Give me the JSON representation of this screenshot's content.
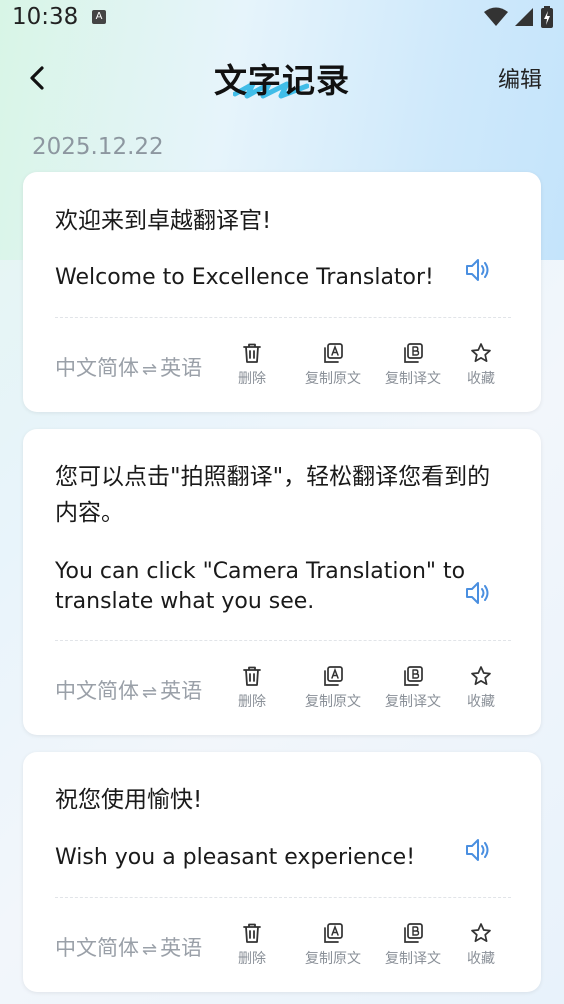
{
  "status": {
    "time": "10:38",
    "notification_badge": "A"
  },
  "header": {
    "title": "文字记录",
    "edit_label": "编辑"
  },
  "date": "2025.12.22",
  "records": [
    {
      "source": "欢迎来到卓越翻译官!",
      "target": "Welcome to Excellence Translator!",
      "lang_from": "中文简体",
      "lang_to": "英语",
      "swap_symbol": "⇌",
      "actions": {
        "delete": "删除",
        "copy_source": "复制原文",
        "copy_target": "复制译文",
        "favorite": "收藏"
      }
    },
    {
      "source": "您可以点击\"拍照翻译\"，轻松翻译您看到的内容。",
      "target": "You can click \"Camera Translation\" to translate what you see.",
      "lang_from": "中文简体",
      "lang_to": "英语",
      "swap_symbol": "⇌",
      "actions": {
        "delete": "删除",
        "copy_source": "复制原文",
        "copy_target": "复制译文",
        "favorite": "收藏"
      }
    },
    {
      "source": "祝您使用愉快!",
      "target": "Wish you a pleasant experience!",
      "lang_from": "中文简体",
      "lang_to": "英语",
      "swap_symbol": "⇌",
      "actions": {
        "delete": "删除",
        "copy_source": "复制原文",
        "copy_target": "复制译文",
        "favorite": "收藏"
      }
    }
  ],
  "colors": {
    "accent": "#4a8fe0",
    "title_deco": "#2fb7e6",
    "muted": "#9aa0a8"
  }
}
